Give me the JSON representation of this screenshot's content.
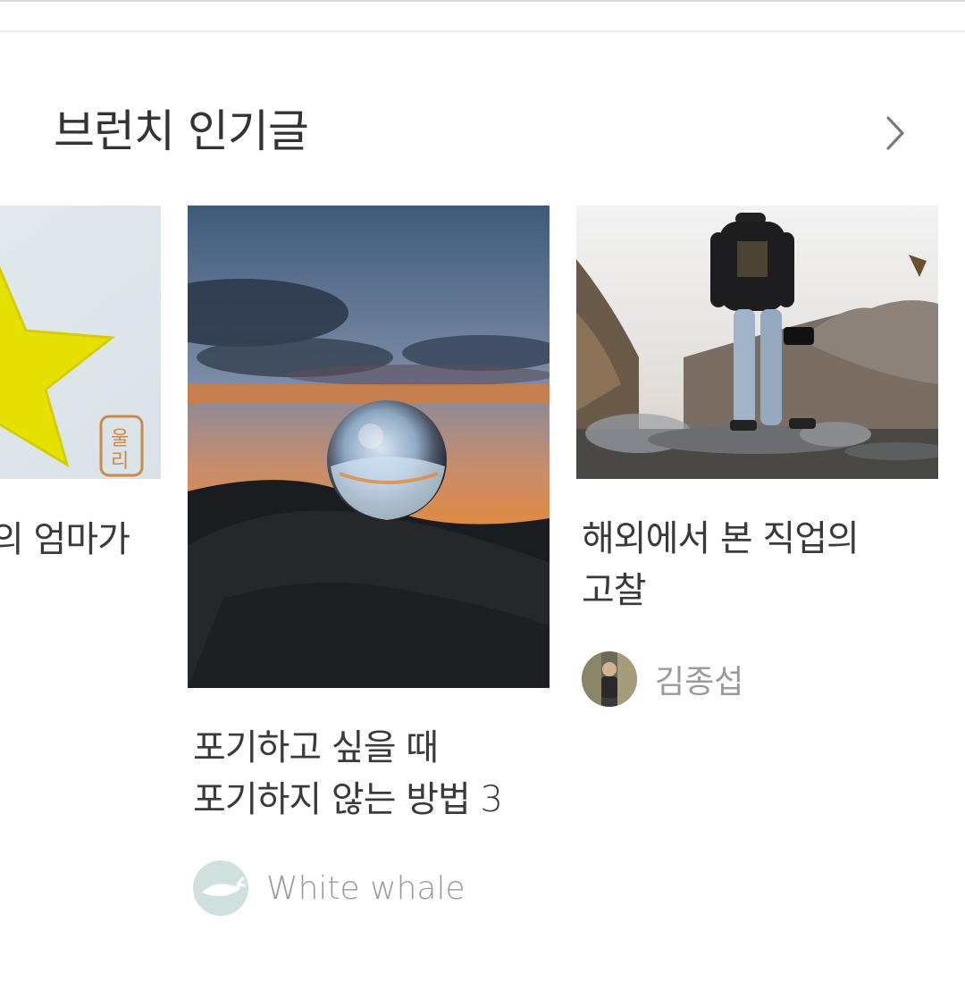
{
  "section": {
    "title": "브런치 인기글",
    "more_icon": "chevron-right-icon"
  },
  "cards": [
    {
      "title_lines": [
        "의 엄마가"
      ],
      "thumbnail": "star-drawing-image"
    },
    {
      "title_lines": [
        "포기하고 싶을 때",
        "포기하지 않는 방법 3"
      ],
      "thumbnail": "crystal-ball-sunset-image",
      "author": {
        "name": "White whale",
        "avatar": "whale-avatar"
      }
    },
    {
      "title_lines": [
        "해외에서 본 직업의",
        "고찰"
      ],
      "thumbnail": "man-on-rocks-image",
      "author": {
        "name": "김종섭",
        "avatar": "person-photo-avatar"
      }
    }
  ],
  "colors": {
    "title_text": "#333333",
    "author_text": "#9a9a9a",
    "whale_avatar_bg": "#cfe0df"
  }
}
